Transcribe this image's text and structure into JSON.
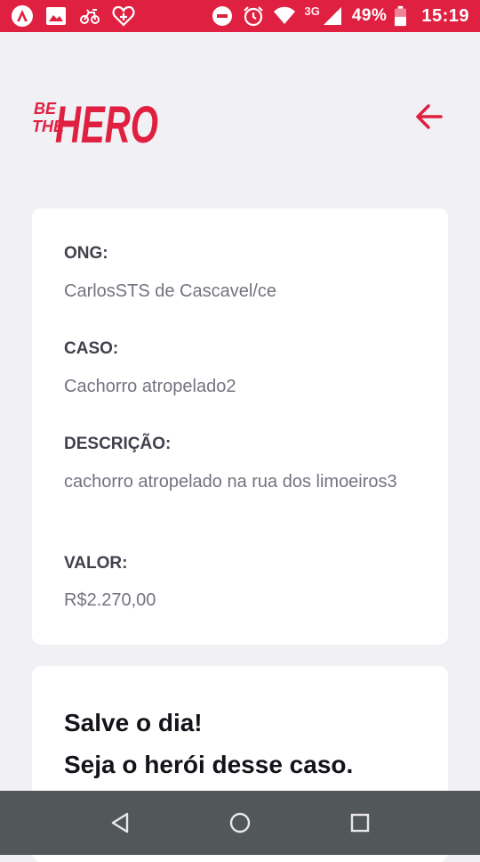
{
  "status_bar": {
    "icons_left": [
      "app-icon",
      "image-icon",
      "vehicle-icon",
      "heart-plus-icon"
    ],
    "icons_right": [
      "do-not-disturb-icon",
      "alarm-icon",
      "wifi-icon",
      "signal-icon",
      "battery-icon"
    ],
    "network": "3G",
    "battery": "49%",
    "time": "15:19"
  },
  "header": {
    "logo": {
      "line1": "BE",
      "line2": "THE",
      "word": "HERO"
    },
    "back_icon": "arrow-left-icon"
  },
  "incident": {
    "ong_label": "ONG:",
    "ong_value": "CarlosSTS de Cascavel/ce",
    "case_label": "CASO:",
    "case_value": "Cachorro atropelado2",
    "description_label": "DESCRIÇÃO:",
    "description_value": "cachorro atropelado na rua dos limoeiros3",
    "value_label": "VALOR:",
    "value_value": "R$2.270,00"
  },
  "contact": {
    "title_line1": "Salve o dia!",
    "title_line2": "Seja o herói desse caso."
  },
  "nav_bar": {
    "back": "nav-back-icon",
    "home": "nav-home-icon",
    "recents": "nav-recents-icon"
  },
  "colors": {
    "brand": "#e02041",
    "background": "#f0f0f5",
    "card": "#ffffff",
    "label": "#41414d",
    "value": "#737380",
    "nav_bar": "#52575a"
  }
}
